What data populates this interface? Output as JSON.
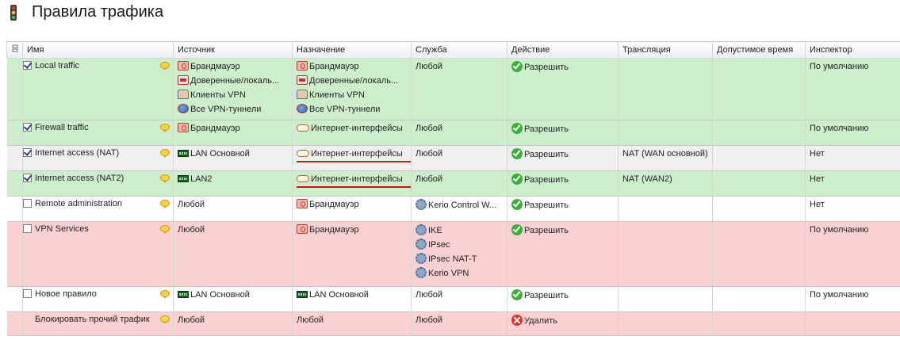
{
  "title": "Правила трафика",
  "columns": {
    "settings": "",
    "name": "Имя",
    "source": "Источник",
    "destination": "Назначение",
    "service": "Служба",
    "action": "Действие",
    "translation": "Трансляция",
    "time": "Допустимое время",
    "inspector": "Инспектор"
  },
  "colors": {
    "allow_row": "#cdeecb",
    "deny_row": "#fbd0d0",
    "selected_row": "#efefef",
    "highlight": "#d01515"
  },
  "rows": [
    {
      "cls": "green",
      "checked": true,
      "name": "Local traffic",
      "source": [
        {
          "icon": "firewall",
          "text": "Брандмауэр"
        },
        {
          "icon": "network",
          "text": "Доверенные/локаль..."
        },
        {
          "icon": "vpnclient",
          "text": "Клиенты VPN"
        },
        {
          "icon": "globe",
          "text": "Все VPN-туннели"
        }
      ],
      "destination": [
        {
          "icon": "firewall",
          "text": "Брандмауэр"
        },
        {
          "icon": "network",
          "text": "Доверенные/локаль..."
        },
        {
          "icon": "vpnclient",
          "text": "Клиенты VPN"
        },
        {
          "icon": "globe",
          "text": "Все VPN-туннели"
        }
      ],
      "service": [
        {
          "icon": "",
          "text": "Любой"
        }
      ],
      "action": {
        "icon": "allow",
        "text": "Разрешить"
      },
      "translation": "",
      "time": "",
      "inspector": "По умолчанию",
      "underline": false
    },
    {
      "cls": "green",
      "checked": true,
      "name": "Firewall traffic",
      "source": [
        {
          "icon": "firewall",
          "text": "Брандмауэр"
        }
      ],
      "destination": [
        {
          "icon": "cloud",
          "text": "Интернет-интерфейсы"
        }
      ],
      "service": [
        {
          "icon": "",
          "text": "Любой"
        }
      ],
      "action": {
        "icon": "allow",
        "text": "Разрешить"
      },
      "translation": "",
      "time": "",
      "inspector": "По умолчанию",
      "underline": false
    },
    {
      "cls": "gray",
      "checked": true,
      "name": "Internet access (NAT)",
      "source": [
        {
          "icon": "lan",
          "text": "LAN Основной"
        }
      ],
      "destination": [
        {
          "icon": "cloud",
          "text": "Интернет-интерфейсы"
        }
      ],
      "service": [
        {
          "icon": "",
          "text": "Любой"
        }
      ],
      "action": {
        "icon": "allow",
        "text": "Разрешить"
      },
      "translation": "NAT (WAN основной)",
      "time": "",
      "inspector": "Нет",
      "underline": true
    },
    {
      "cls": "green",
      "checked": true,
      "name": "Internet access (NAT2)",
      "source": [
        {
          "icon": "lan",
          "text": "LAN2"
        }
      ],
      "destination": [
        {
          "icon": "cloud",
          "text": "Интернет-интерфейсы"
        }
      ],
      "service": [
        {
          "icon": "",
          "text": "Любой"
        }
      ],
      "action": {
        "icon": "allow",
        "text": "Разрешить"
      },
      "translation": "NAT (WAN2)",
      "time": "",
      "inspector": "Нет",
      "underline": true
    },
    {
      "cls": "white",
      "checked": false,
      "name": "Remote administration",
      "source": [
        {
          "icon": "",
          "text": "Любой"
        }
      ],
      "destination": [
        {
          "icon": "firewall",
          "text": "Брандмауэр"
        }
      ],
      "service": [
        {
          "icon": "gear",
          "text": "Kerio Control W..."
        }
      ],
      "action": {
        "icon": "allow",
        "text": "Разрешить"
      },
      "translation": "",
      "time": "",
      "inspector": "Нет",
      "underline": false
    },
    {
      "cls": "pink",
      "checked": false,
      "name": "VPN Services",
      "source": [
        {
          "icon": "",
          "text": "Любой"
        }
      ],
      "destination": [
        {
          "icon": "firewall",
          "text": "Брандмауэр"
        }
      ],
      "service": [
        {
          "icon": "gear",
          "text": "IKE"
        },
        {
          "icon": "gear",
          "text": "IPsec"
        },
        {
          "icon": "gear",
          "text": "IPsec NAT-T"
        },
        {
          "icon": "gear",
          "text": "Kerio VPN"
        }
      ],
      "action": {
        "icon": "allow",
        "text": "Разрешить"
      },
      "translation": "",
      "time": "",
      "inspector": "По умолчанию",
      "underline": false
    },
    {
      "cls": "white",
      "checked": false,
      "name": "Новое правило",
      "source": [
        {
          "icon": "lan",
          "text": "LAN Основной"
        }
      ],
      "destination": [
        {
          "icon": "lan",
          "text": "LAN Основной"
        }
      ],
      "service": [
        {
          "icon": "",
          "text": "Любой"
        }
      ],
      "action": {
        "icon": "allow",
        "text": "Разрешить"
      },
      "translation": "",
      "time": "",
      "inspector": "По умолчанию",
      "underline": false
    },
    {
      "cls": "pink",
      "checked": null,
      "name": "Блокировать прочий трафик",
      "source": [
        {
          "icon": "",
          "text": "Любой"
        }
      ],
      "destination": [
        {
          "icon": "",
          "text": "Любой"
        }
      ],
      "service": [
        {
          "icon": "",
          "text": "Любой"
        }
      ],
      "action": {
        "icon": "deny",
        "text": "Удалить"
      },
      "translation": "",
      "time": "",
      "inspector": "",
      "underline": false
    }
  ]
}
